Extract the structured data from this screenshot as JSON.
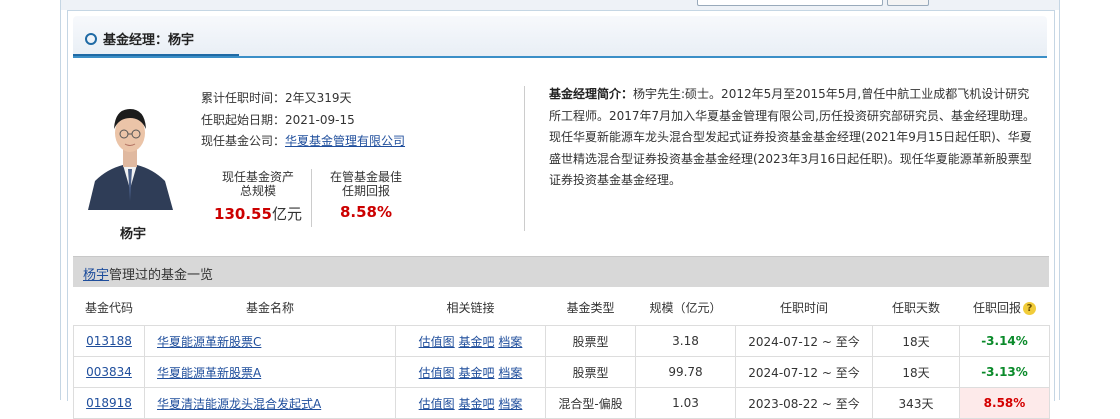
{
  "header": {
    "title": "基金经理：杨宇"
  },
  "manager": {
    "name": "杨宇",
    "tenure_label": "累计任职时间：",
    "tenure": "2年又319天",
    "start_label": "任职起始日期：",
    "start": "2021-09-15",
    "company_label": "现任基金公司：",
    "company": "华夏基金管理有限公司"
  },
  "stats": {
    "assets_label_1": "现任基金资产",
    "assets_label_2": "总规模",
    "assets_value": "130.55",
    "assets_unit": "亿元",
    "best_label_1": "在管基金最佳",
    "best_label_2": "任期回报",
    "best_value": "8.58%"
  },
  "bio": {
    "label": "基金经理简介：",
    "text": "杨宇先生:硕士。2012年5月至2015年5月,曾任中航工业成都飞机设计研究所工程师。2017年7月加入华夏基金管理有限公司,历任投资研究部研究员、基金经理助理。现任华夏新能源车龙头混合型发起式证券投资基金基金经理(2021年9月15日起任职)、华夏盛世精选混合型证券投资基金基金经理(2023年3月16日起任职)。现任华夏能源革新股票型证券投资基金基金经理。"
  },
  "list": {
    "name_link": "杨宇",
    "title_suffix": "管理过的基金一览"
  },
  "table": {
    "headers": [
      "基金代码",
      "基金名称",
      "相关链接",
      "基金类型",
      "规模（亿元）",
      "任职时间",
      "任职天数",
      "任职回报"
    ],
    "links": [
      "估值图",
      "基金吧",
      "档案"
    ],
    "rows": [
      {
        "code": "013188",
        "name": "华夏能源革新股票C",
        "type": "股票型",
        "size": "3.18",
        "period": "2024-07-12 ~ 至今",
        "days": "18天",
        "ret": "-3.14%"
      },
      {
        "code": "003834",
        "name": "华夏能源革新股票A",
        "type": "股票型",
        "size": "99.78",
        "period": "2024-07-12 ~ 至今",
        "days": "18天",
        "ret": "-3.13%"
      },
      {
        "code": "018918",
        "name": "华夏清洁能源龙头混合发起式A",
        "type": "混合型-偏股",
        "size": "1.03",
        "period": "2023-08-22 ~ 至今",
        "days": "343天",
        "ret": "8.58%"
      }
    ]
  },
  "colors": {
    "accent": "#1f6aa5",
    "negative": "#0a8a2a",
    "positive": "#d40000"
  }
}
